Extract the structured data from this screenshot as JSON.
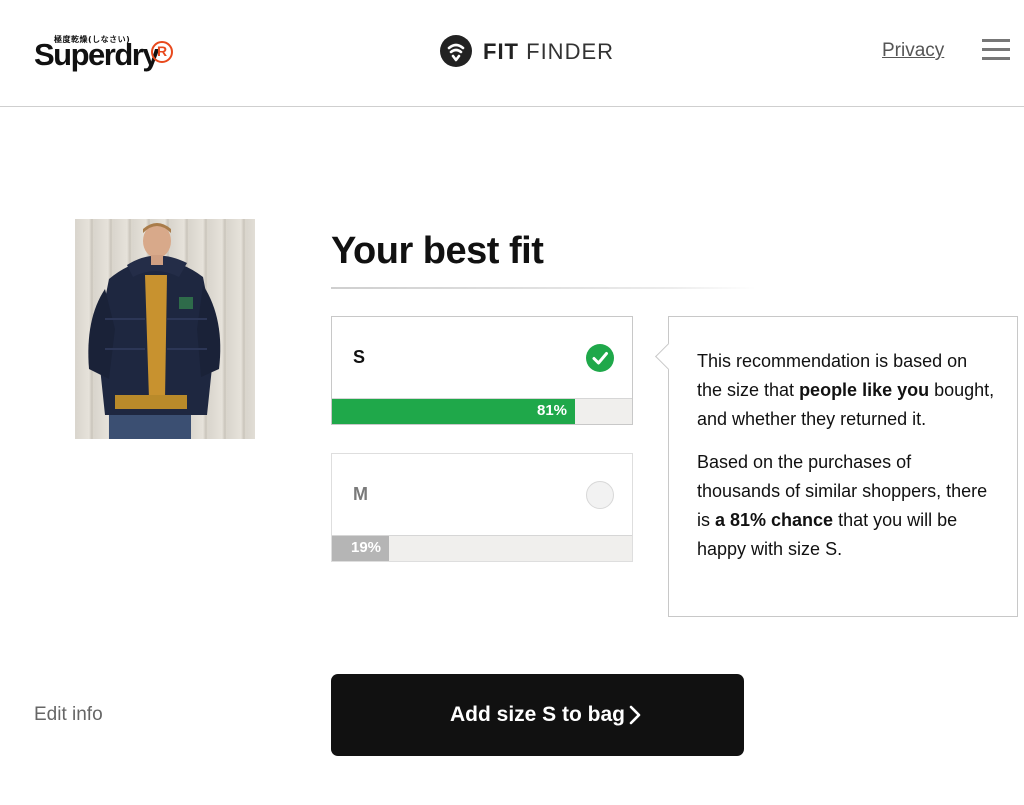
{
  "header": {
    "brand": "Superdry",
    "brand_jp": "極度乾燥(しなさい)",
    "brand_mark": "R",
    "fitfinder_bold": "FIT",
    "fitfinder_light": "FINDER",
    "privacy_label": "Privacy",
    "menu_icon": "hamburger-menu-icon"
  },
  "product": {
    "image": "jacket-model-photo"
  },
  "main": {
    "heading": "Your best fit",
    "sizes": [
      {
        "label": "S",
        "percent_label": "81%",
        "probability": 0.81,
        "selected": true,
        "icon": "check-circle-icon",
        "color": "#1fa84a"
      },
      {
        "label": "M",
        "percent_label": "19%",
        "probability": 0.19,
        "selected": false,
        "icon": "radio-empty-icon",
        "color": "#b5b5b5"
      }
    ]
  },
  "info": {
    "p1_before": "This recommendation is based on the size that ",
    "p1_bold": "people like you",
    "p1_after": " bought, and whether they returned it.",
    "p2_before": "Based on the purchases of thousands of similar shoppers, there is ",
    "p2_bold": "a 81% chance",
    "p2_after": " that you will be happy with size S."
  },
  "actions": {
    "edit_info": "Edit info",
    "add_to_bag": "Add size S to bag",
    "add_icon": "chevron-right-icon"
  },
  "colors": {
    "accent_green": "#1fa84a",
    "brand_orange": "#e8491d",
    "button_bg": "#111111"
  }
}
